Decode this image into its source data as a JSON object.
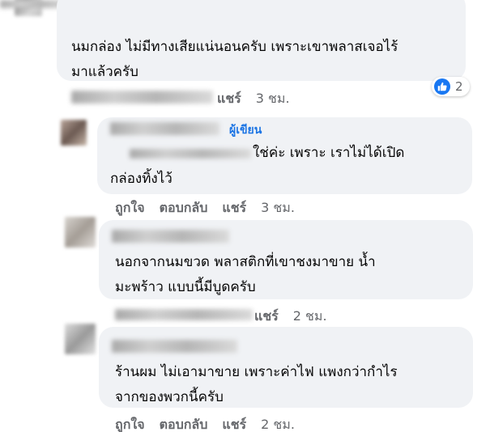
{
  "comments": [
    {
      "text_lines": [
        "นมกล่อง ไม่มีทางเสียแน่นอนครับ เพราะเขาพลาสเจอไร้",
        "มาแล้วครับ"
      ],
      "actions": [
        "",
        "",
        "แชร์"
      ],
      "time": "3 ชม.",
      "reaction_count": "2"
    },
    {
      "badge": "ผู้เขียน",
      "text_lines": [
        "ใช่ค่ะ เพราะ เราไม่ได้เปิด",
        "กล่องทิ้งไว้"
      ],
      "actions": [
        "ถูกใจ",
        "ตอบกลับ",
        "แชร์"
      ],
      "time": "3 ชม."
    },
    {
      "text_lines": [
        "นอกจากนมขวด พลาสติกที่เขาชงมาขาย น้ำ",
        "มะพร้าว แบบนี้มีบูดครับ"
      ],
      "actions": [
        "",
        "",
        "แชร์"
      ],
      "time": "2 ชม."
    },
    {
      "text_lines": [
        "ร้านผม ไม่เอามาขาย เพราะค่าไฟ แพงกว่ากำไร",
        "จากของพวกนี้ครับ"
      ],
      "actions": [
        "ถูกใจ",
        "ตอบกลับ",
        "แชร์"
      ],
      "time": "2 ชม."
    }
  ],
  "colors": {
    "bubble": "#f0f2f5",
    "action_text": "#65676b",
    "author_badge": "#1b74e4",
    "like_blue": "#1877f2"
  },
  "icons": {
    "reaction": "like-thumb-icon"
  }
}
